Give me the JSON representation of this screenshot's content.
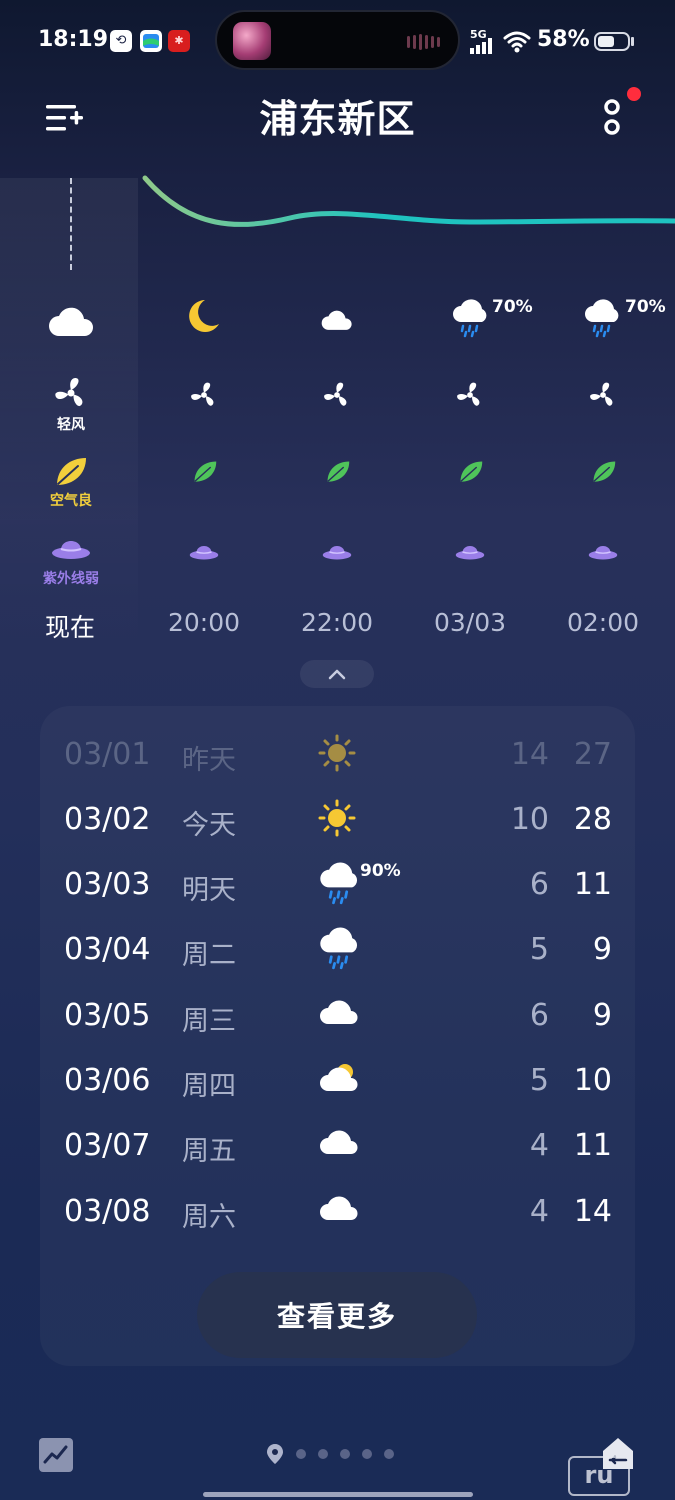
{
  "status_bar": {
    "time": "18:19",
    "network": "5G",
    "battery_percent": "58%",
    "battery_level": 0.58
  },
  "header": {
    "title": "浦东新区",
    "has_notification": true
  },
  "hourly": {
    "columns": [
      {
        "time": "现在",
        "weather_icon": "partly-cloudy-night-icon",
        "precip": "",
        "wind_label": "轻风",
        "air_label": "空气良",
        "uv_label": "紫外线弱"
      },
      {
        "time": "20:00",
        "weather_icon": "moon-icon",
        "precip": "",
        "wind_label": "",
        "air_label": "",
        "uv_label": ""
      },
      {
        "time": "22:00",
        "weather_icon": "partly-cloudy-night-icon",
        "precip": "",
        "wind_label": "",
        "air_label": "",
        "uv_label": ""
      },
      {
        "time": "03/03",
        "weather_icon": "rain-icon",
        "precip": "70%",
        "wind_label": "",
        "air_label": "",
        "uv_label": ""
      },
      {
        "time": "02:00",
        "weather_icon": "rain-icon",
        "precip": "70%",
        "wind_label": "",
        "air_label": "",
        "uv_label": ""
      }
    ]
  },
  "daily": {
    "days": [
      {
        "date": "03/01",
        "name": "昨天",
        "icon": "sun-icon",
        "precip": "",
        "low": "14",
        "high": "27",
        "past": true
      },
      {
        "date": "03/02",
        "name": "今天",
        "icon": "sun-icon",
        "precip": "",
        "low": "10",
        "high": "28",
        "past": false
      },
      {
        "date": "03/03",
        "name": "明天",
        "icon": "rain-icon",
        "precip": "90%",
        "low": "6",
        "high": "11",
        "past": false
      },
      {
        "date": "03/04",
        "name": "周二",
        "icon": "rain-icon",
        "precip": "",
        "low": "5",
        "high": "9",
        "past": false
      },
      {
        "date": "03/05",
        "name": "周三",
        "icon": "cloud-icon",
        "precip": "",
        "low": "6",
        "high": "9",
        "past": false
      },
      {
        "date": "03/06",
        "name": "周四",
        "icon": "partly-cloudy-icon",
        "precip": "",
        "low": "5",
        "high": "10",
        "past": false
      },
      {
        "date": "03/07",
        "name": "周五",
        "icon": "cloud-icon",
        "precip": "",
        "low": "4",
        "high": "11",
        "past": false
      },
      {
        "date": "03/08",
        "name": "周六",
        "icon": "cloud-icon",
        "precip": "",
        "low": "4",
        "high": "14",
        "past": false
      }
    ],
    "more_label": "查看更多"
  },
  "footer": {
    "page_count": 6,
    "active_page": 0
  },
  "colors": {
    "accent_teal": "#1fc3c0",
    "air_good_yellow": "#f2cf3c",
    "leaf_green": "#4fc45a",
    "uv_purple": "#9a7ee8",
    "notification_red": "#ff2d3d"
  }
}
